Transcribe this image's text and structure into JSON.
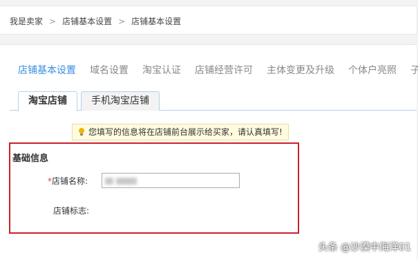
{
  "breadcrumb": {
    "items": [
      "我是卖家",
      "店铺基本设置",
      "店铺基本设置"
    ],
    "separator": ">"
  },
  "top_tabs": [
    "店铺基本设置",
    "域名设置",
    "淘宝认证",
    "店铺经营许可",
    "主体变更及升级",
    "个体户亮照",
    "子"
  ],
  "sub_tabs": [
    "淘宝店铺",
    "手机淘宝店铺"
  ],
  "notice": {
    "icon": "lightbulb-icon",
    "text": "您填写的信息将在店铺前台展示给买家，请认真填写!"
  },
  "form": {
    "section_title": "基础信息",
    "required_mark": "*",
    "store_name_label": "店铺名称:",
    "store_logo_label": "店铺标志:"
  },
  "watermark": "头条 @沙漠中海洋01",
  "colors": {
    "accent": "#3a8ee6",
    "highlight_box": "#c9202a",
    "required": "#e4393c"
  }
}
